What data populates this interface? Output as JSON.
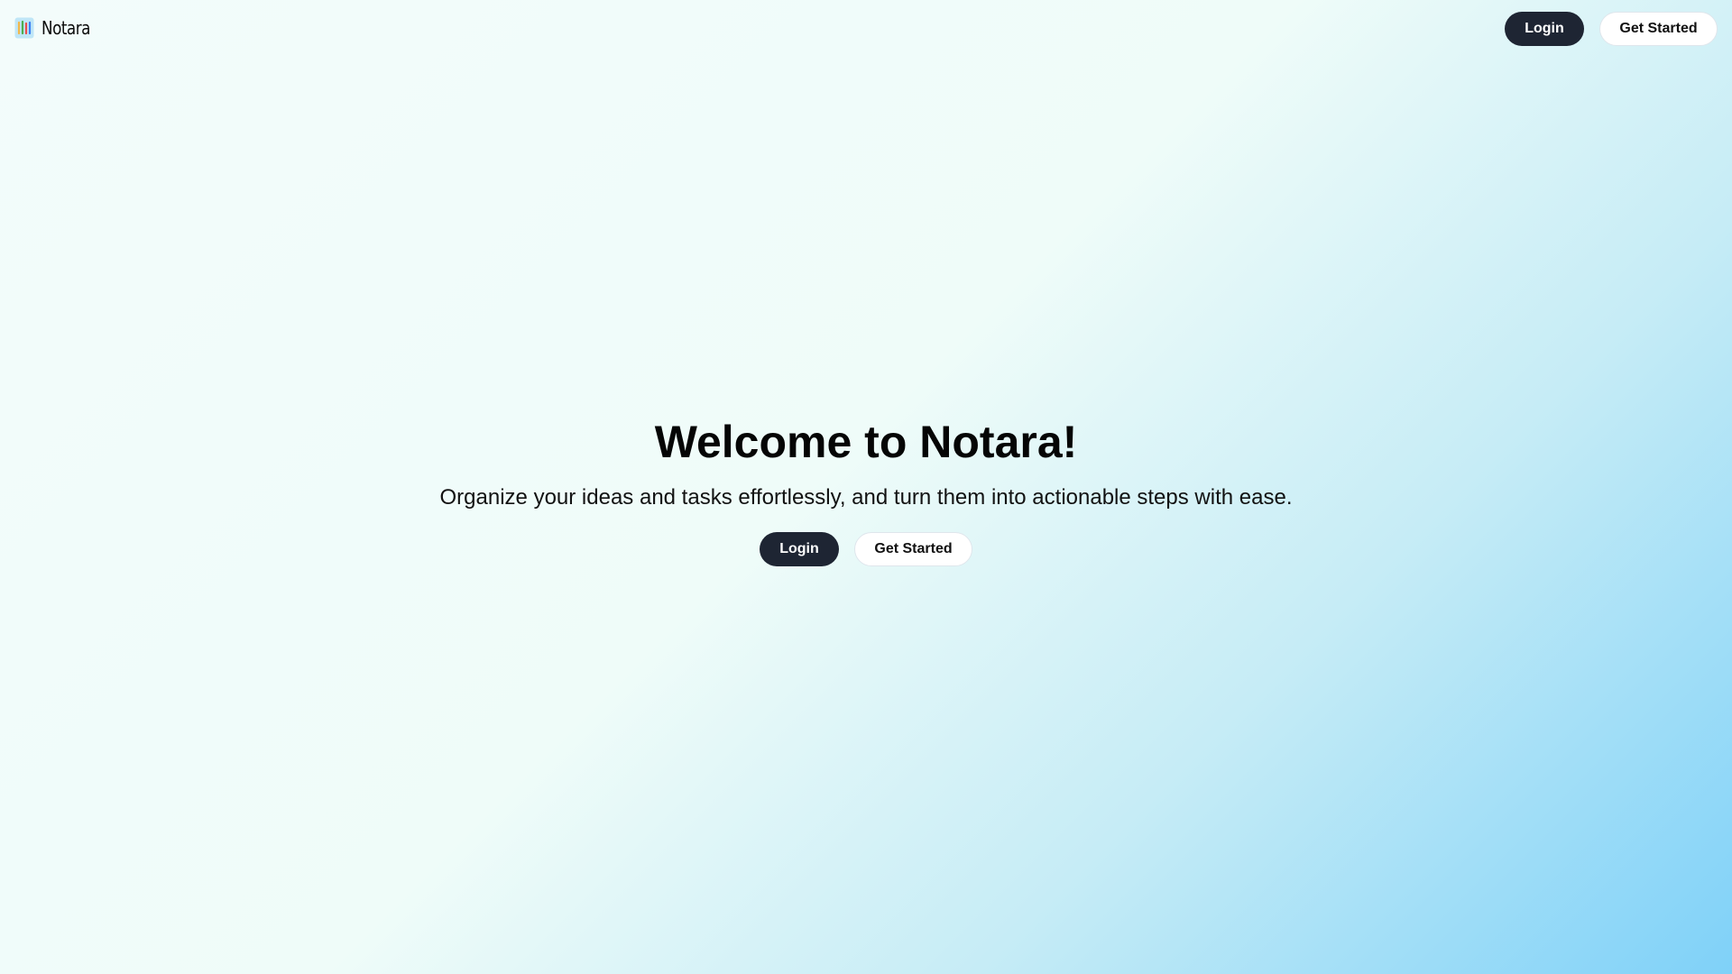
{
  "navbar": {
    "brand_name": "Notara",
    "login_label": "Login",
    "get_started_label": "Get Started"
  },
  "hero": {
    "title": "Welcome to Notara!",
    "subtitle": "Organize your ideas and tasks effortlessly, and turn them into actionable steps with ease.",
    "login_label": "Login",
    "get_started_label": "Get Started"
  },
  "colors": {
    "primary_button": "#1e2533",
    "gradient_end": "#7fd1f8",
    "gradient_start": "#f3fcfb"
  },
  "icons": {
    "logo": "notara-logo-icon"
  }
}
